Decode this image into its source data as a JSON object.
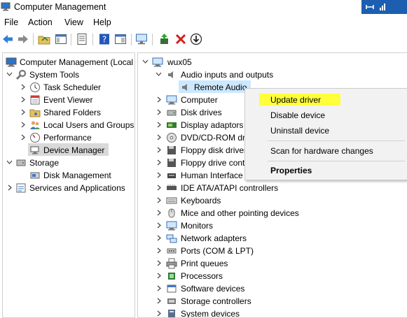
{
  "window": {
    "title": "Computer Management"
  },
  "menu": [
    "File",
    "Action",
    "View",
    "Help"
  ],
  "left_tree": {
    "root": "Computer Management (Local",
    "system_tools": "System Tools",
    "system_tools_children": [
      "Task Scheduler",
      "Event Viewer",
      "Shared Folders",
      "Local Users and Groups",
      "Performance",
      "Device Manager"
    ],
    "storage": "Storage",
    "storage_children": [
      "Disk Management"
    ],
    "services": "Services and Applications"
  },
  "right_tree": {
    "root": "wux05",
    "audio_category": "Audio inputs and outputs",
    "audio_child": "Remote Audio",
    "categories": [
      "Computer",
      "Disk drives",
      "Display adaptors",
      "DVD/CD-ROM dri",
      "Floppy disk drives",
      "Floppy drive cont",
      "Human Interface",
      "IDE ATA/ATAPI controllers",
      "Keyboards",
      "Mice and other pointing devices",
      "Monitors",
      "Network adapters",
      "Ports (COM & LPT)",
      "Print queues",
      "Processors",
      "Software devices",
      "Storage controllers",
      "System devices"
    ]
  },
  "context_menu": {
    "update": "Update driver",
    "disable": "Disable device",
    "uninstall": "Uninstall device",
    "scan": "Scan for hardware changes",
    "properties": "Properties"
  },
  "colors": {
    "highlight": "#ffff3c",
    "selection": "#cce8ff",
    "tray": "#1c5fb0"
  }
}
